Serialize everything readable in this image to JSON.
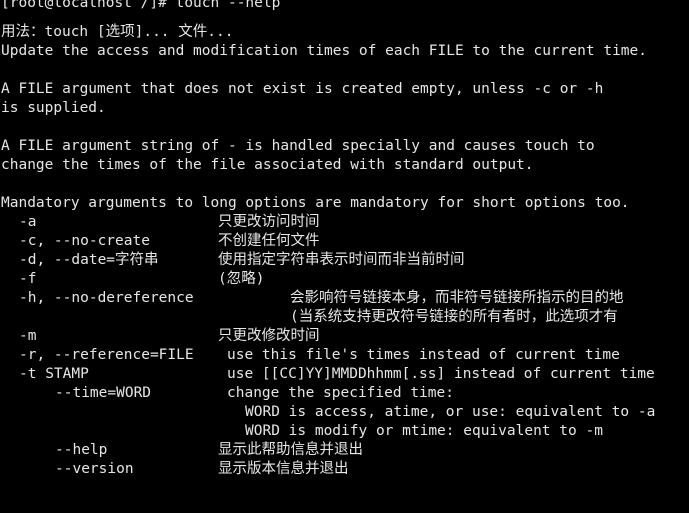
{
  "terminal": {
    "colors": {
      "background": "#000000",
      "foreground": "#e6e6e6"
    },
    "prompt_line": "[root@localhost /]# touch --help",
    "usage": "用法：touch [选项]... 文件...",
    "desc_line1": "Update the access and modification times of each FILE to the current time.",
    "desc_line2": "A FILE argument that does not exist is created empty, unless -c or -h",
    "desc_line3": "is supplied.",
    "desc_line4": "A FILE argument string of - is handled specially and causes touch to",
    "desc_line5": "change the times of the file associated with standard output.",
    "mandatory_line": "Mandatory arguments to long options are mandatory for short options too.",
    "options": [
      {
        "flag": "-a",
        "desc": "只更改访问时间"
      },
      {
        "flag": "-c, --no-create",
        "desc": "不创建任何文件"
      },
      {
        "flag": "-d, --date=字符串",
        "desc": "使用指定字符串表示时间而非当前时间"
      },
      {
        "flag": "-f",
        "desc": "(忽略)"
      },
      {
        "flag": "-h, --no-dereference",
        "desc": "会影响符号链接本身，而非符号链接所指示的目的地",
        "desc_cont": "(当系统支持更改符号链接的所有者时，此选项才有"
      },
      {
        "flag": "-m",
        "desc": "只更改修改时间"
      },
      {
        "flag": "-r, --reference=FILE",
        "desc": "use this file's times instead of current time"
      },
      {
        "flag": "-t STAMP",
        "desc": "use [[CC]YY]MMDDhhmm[.ss] instead of current time"
      },
      {
        "flag": "--time=WORD",
        "desc": "change the specified time:",
        "desc_cont1": "WORD is access, atime, or use: equivalent to -a",
        "desc_cont2": "WORD is modify or mtime: equivalent to -m"
      },
      {
        "flag": "--help",
        "desc": "显示此帮助信息并退出"
      },
      {
        "flag": "--version",
        "desc": "显示版本信息并退出"
      }
    ]
  }
}
